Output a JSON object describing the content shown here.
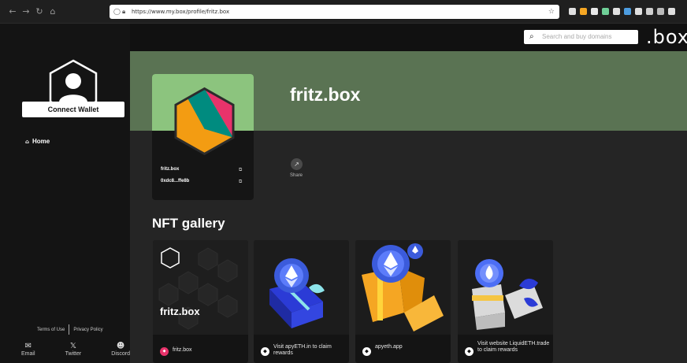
{
  "browser": {
    "url": "https://www.my.box/profile/fritz.box",
    "extension_colors": [
      "#e0e0e0",
      "#f5a623",
      "#e8e8e8",
      "#6fcf97",
      "#e0e0e0",
      "#4d9de0",
      "#e0e0e0",
      "#cfcfcf",
      "#bbbbbb",
      "#e0e0e0"
    ]
  },
  "header": {
    "search_placeholder": "Search and buy domains",
    "brand": ".box"
  },
  "sidebar": {
    "connect_wallet": "Connect Wallet",
    "home": "Home",
    "terms": "Terms of Use",
    "privacy": "Privacy Policy",
    "social": [
      {
        "label": "Email",
        "icon": "email-icon"
      },
      {
        "label": "Twitter",
        "icon": "x-icon"
      },
      {
        "label": "Discord",
        "icon": "discord-icon"
      }
    ]
  },
  "profile": {
    "title": "fritz.box",
    "name": "fritz.box",
    "address": "0xdc8...ffe8b",
    "share": "Share",
    "colors": {
      "hero": "#5a7353",
      "card_top": "#8cc47e",
      "pink": "#e8336b",
      "teal": "#008b7f",
      "orange": "#f39c12",
      "charcoal": "#2c2c2c"
    }
  },
  "gallery": {
    "title": "NFT gallery",
    "items": [
      {
        "image_text": "fritz.box",
        "label": "fritz.box",
        "icon": "box-badge-icon"
      },
      {
        "image_text": "",
        "label": "Visit apyETH.in to claim rewards",
        "icon": "eth-badge-icon"
      },
      {
        "image_text": "",
        "label": "apyeth.app",
        "icon": "eth-badge-icon"
      },
      {
        "image_text": "",
        "label": "Visit website LiquidETH.trade to claim rewards",
        "icon": "eth-badge-icon"
      }
    ]
  }
}
